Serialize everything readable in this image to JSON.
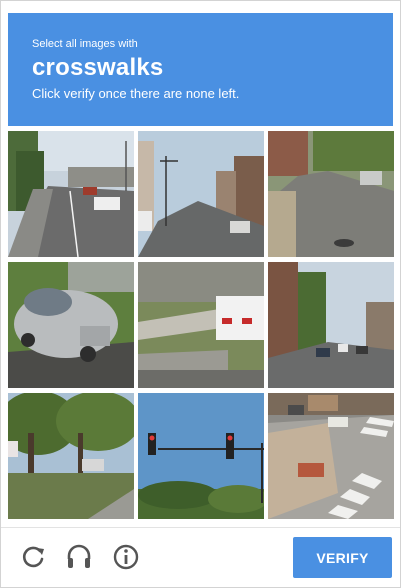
{
  "header": {
    "instruction": "Select all images with",
    "target": "crosswalks",
    "subtext": "Click verify once there are none left."
  },
  "tiles": [
    {
      "description": "street-road-scene"
    },
    {
      "description": "downtown-street"
    },
    {
      "description": "residential-street"
    },
    {
      "description": "silver-car-on-grass"
    },
    {
      "description": "sidewalk-and-white-car"
    },
    {
      "description": "city-street-with-cars"
    },
    {
      "description": "trees-and-sidewalk"
    },
    {
      "description": "traffic-lights"
    },
    {
      "description": "intersection-crosswalk"
    }
  ],
  "controls": {
    "reload_icon": "reload-icon",
    "audio_icon": "headphones-icon",
    "info_icon": "info-icon"
  },
  "verify_label": "VERIFY",
  "colors": {
    "accent": "#4a90e2",
    "icon": "#555555"
  }
}
